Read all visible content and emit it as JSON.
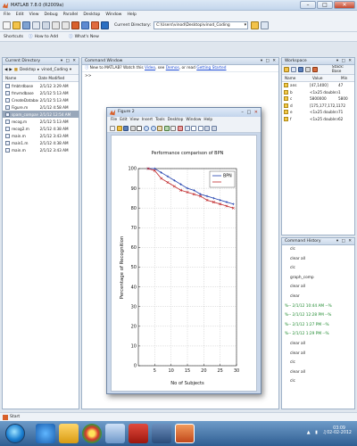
{
  "app": {
    "title": "MATLAB  7.8.0 (R2009a)"
  },
  "menu": [
    "File",
    "Edit",
    "View",
    "Debug",
    "Parallel",
    "Desktop",
    "Window",
    "Help"
  ],
  "toolbar": {
    "current_dir_label": "Current Directory:",
    "current_dir": "C:\\Users\\vinod\\Desktop\\vinod_Coding"
  },
  "shortcuts": {
    "label": "Shortcuts",
    "how_to_add": "How to Add",
    "whats_new": "What's New"
  },
  "left_panel": {
    "title": "Current Directory",
    "path": [
      "Desktop",
      "vinod_Coding"
    ],
    "col_name": "Name",
    "col_date": "Date Modified",
    "files": [
      {
        "name": "fmbtrdbase",
        "date": "2/1/12 3:29 AM"
      },
      {
        "name": "fmvmdbase",
        "date": "2/1/12 5:13 AM"
      },
      {
        "name": "CreateDatabase.m",
        "date": "2/1/12 5:13 AM"
      },
      {
        "name": "Figure.m",
        "date": "2/1/12 4:58 AM"
      },
      {
        "name": "spam_compare.m",
        "date": "2/1/12 12:54 AM"
      },
      {
        "name": "recog.m",
        "date": "2/1/12 5:13 AM"
      },
      {
        "name": "recog2.m",
        "date": "2/1/12 4:38 AM"
      },
      {
        "name": "main.m",
        "date": "2/1/12 3:43 AM"
      },
      {
        "name": "main1.m",
        "date": "2/1/12 4:38 AM"
      },
      {
        "name": "main.m",
        "date": "2/1/12 3:43 AM"
      }
    ],
    "selected_index": 4
  },
  "command_window": {
    "title": "Command Window",
    "info_new": "New to MATLAB? Watch this",
    "link_video": "Video",
    "info_see": ", see",
    "link_demos": "Demos",
    "info_read": ", or read",
    "link_started": "Getting Started",
    "prompt": ">>"
  },
  "figure": {
    "title": "Figure 2",
    "menu": [
      "File",
      "Edit",
      "View",
      "Insert",
      "Tools",
      "Desktop",
      "Window",
      "Help"
    ]
  },
  "chart_data": {
    "type": "line",
    "title": "Performance comparison of BPN",
    "xlabel": "No of Subjects",
    "ylabel": "Percentage of Recognition",
    "xlim": [
      0,
      30
    ],
    "ylim": [
      0,
      100
    ],
    "xticks": [
      5,
      10,
      15,
      20,
      25,
      30
    ],
    "yticks": [
      0,
      10,
      20,
      30,
      40,
      50,
      60,
      70,
      80,
      90,
      100
    ],
    "grid": true,
    "legend_position": "top-right",
    "x": [
      3,
      5,
      7,
      9,
      11,
      13,
      15,
      17,
      19,
      21,
      23,
      25,
      27,
      29
    ],
    "series": [
      {
        "name": "BPN",
        "color": "#1f3fae",
        "marker": "+",
        "values": [
          100,
          100,
          98,
          96,
          94,
          92,
          90,
          89,
          87,
          86,
          85,
          84,
          83,
          82
        ]
      },
      {
        "name": "",
        "color": "#c0282b",
        "marker": "x",
        "values": [
          100,
          99,
          95,
          93,
          91,
          89,
          88,
          87,
          86,
          84,
          83,
          82,
          81,
          80
        ]
      }
    ]
  },
  "workspace": {
    "title": "Workspace",
    "stack_label": "Stack: Base",
    "col_name": "Name",
    "col_value": "Value",
    "col_min": "Min",
    "vars": [
      {
        "name": "ans",
        "value": "[47,1400]",
        "min": "47"
      },
      {
        "name": "b",
        "value": "<1x25 double>",
        "min": "1"
      },
      {
        "name": "c",
        "value": "5800000",
        "min": "5800"
      },
      {
        "name": "d",
        "value": "[175,177,172,178...]",
        "min": "172"
      },
      {
        "name": "e",
        "value": "<1x25 double>",
        "min": "71"
      },
      {
        "name": "f",
        "value": "<1x25 double>",
        "min": "62"
      }
    ]
  },
  "history": {
    "title": "Command History",
    "lines": [
      {
        "text": "clc",
        "ts": false
      },
      {
        "text": "clear all",
        "ts": false
      },
      {
        "text": "clc",
        "ts": false
      },
      {
        "text": "graph_comp",
        "ts": false
      },
      {
        "text": "clear all",
        "ts": false
      },
      {
        "text": "clear",
        "ts": false
      },
      {
        "text": "%-- 2/1/12 10:44 AM --%",
        "ts": true
      },
      {
        "text": "%-- 2/1/12 12:28 PM --%",
        "ts": true
      },
      {
        "text": "%-- 2/1/12 1:27 PM --%",
        "ts": true
      },
      {
        "text": "%-- 2/1/12 1:29 PM --%",
        "ts": true
      },
      {
        "text": "clear all",
        "ts": false
      },
      {
        "text": "clear all",
        "ts": false
      },
      {
        "text": "clc",
        "ts": false
      },
      {
        "text": "clear all",
        "ts": false
      },
      {
        "text": "clc",
        "ts": false
      }
    ]
  },
  "start_label": "Start",
  "clock": {
    "time": "03:09",
    "date": "02-02-2012"
  }
}
